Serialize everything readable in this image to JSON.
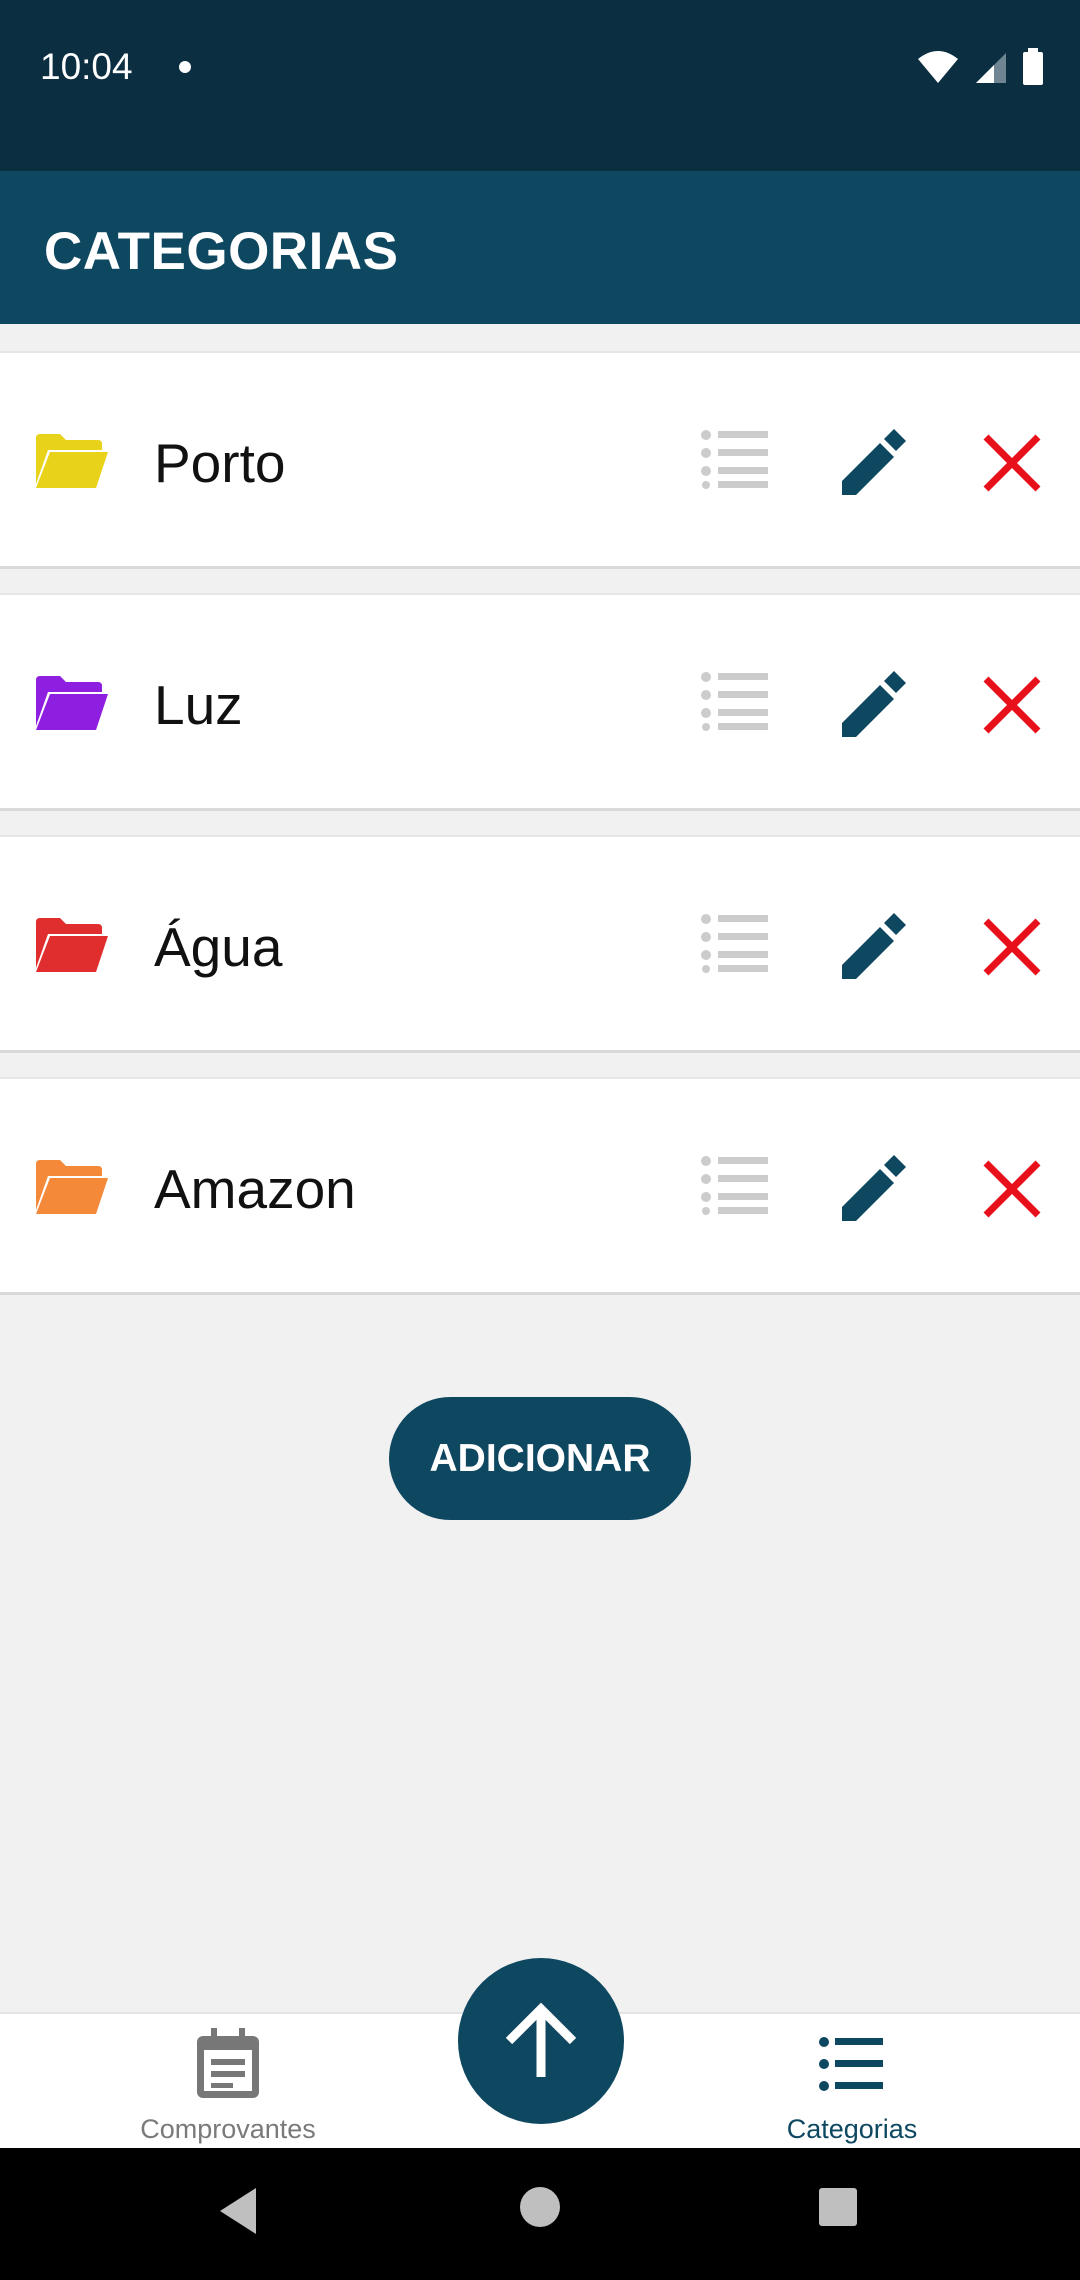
{
  "status_bar": {
    "time": "10:04"
  },
  "app_bar": {
    "title": "CATEGORIAS"
  },
  "categories": [
    {
      "name": "Porto",
      "folder_color": "#e8d21a"
    },
    {
      "name": "Luz",
      "folder_color": "#8e1fe0"
    },
    {
      "name": "Água",
      "folder_color": "#e02e2e"
    },
    {
      "name": "Amazon",
      "folder_color": "#f5893a"
    }
  ],
  "add_button": {
    "label": "ADICIONAR"
  },
  "bottom_nav": {
    "items": [
      {
        "label": "Comprovantes",
        "icon": "calendar-icon",
        "active": false
      },
      {
        "label": "Categorias",
        "icon": "list-icon",
        "active": true
      }
    ],
    "fab_icon": "arrow-up-icon"
  },
  "colors": {
    "primary": "#0e4760",
    "status_bar": "#0b2e40",
    "delete": "#e8101a",
    "list_icon": "#cccccc",
    "inactive_nav": "#7a7a7a"
  }
}
